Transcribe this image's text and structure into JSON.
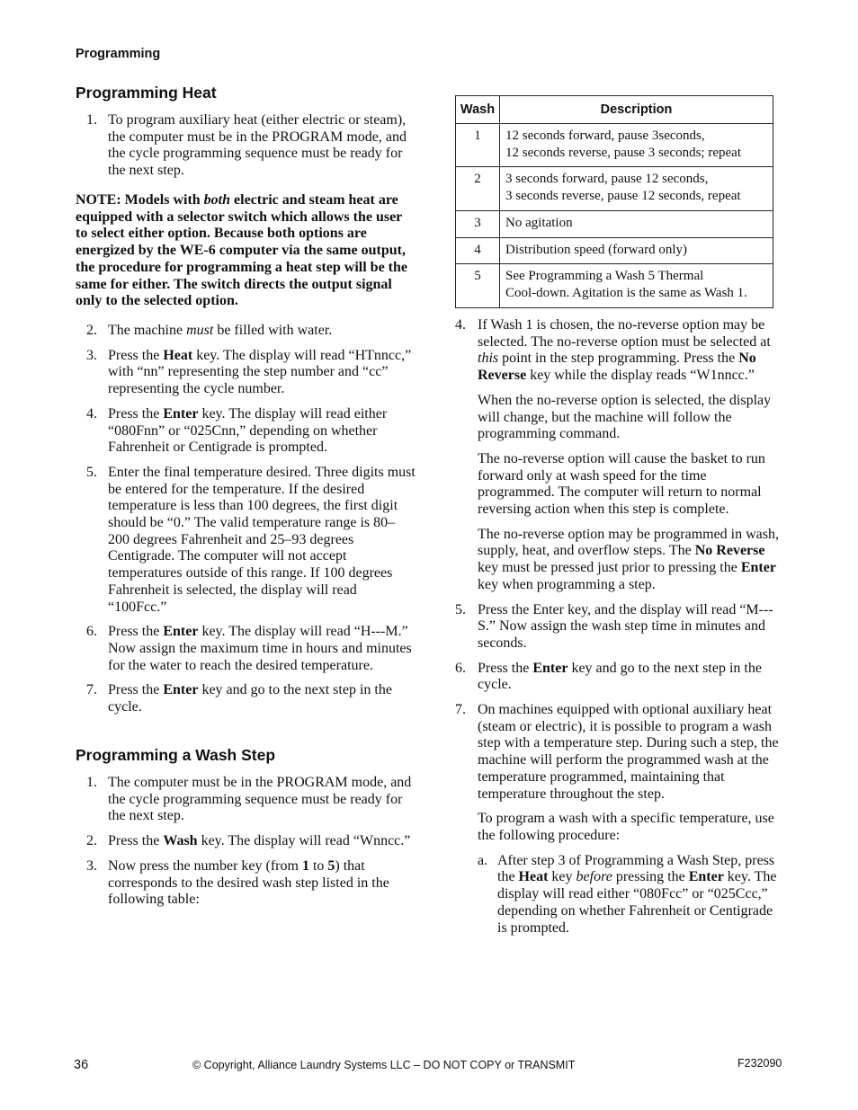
{
  "header": {
    "running_title": "Programming"
  },
  "section_heat": {
    "title": "Programming Heat",
    "step1": {
      "num": "1.",
      "text": [
        {
          "t": "To program auxiliary heat (either electric or steam), the computer must be in the PROGRAM mode, and the cycle programming sequence must be ready for the next step."
        }
      ]
    },
    "note": [
      {
        "t": "NOTE: Models with "
      },
      {
        "t": "both",
        "i": true
      },
      {
        "t": " electric and steam heat are equipped with a selector switch which allows the user to select either option. Because both options are energized by the WE-6 computer via the same output, the procedure for programming a heat step will be the same for either. The switch directs the output signal only to the selected option."
      }
    ],
    "steps": [
      {
        "num": "2.",
        "text": [
          {
            "t": "The machine "
          },
          {
            "t": "must",
            "i": true
          },
          {
            "t": " be filled with water."
          }
        ]
      },
      {
        "num": "3.",
        "text": [
          {
            "t": "Press the "
          },
          {
            "t": "Heat",
            "b": true
          },
          {
            "t": " key. The display will read “HTnncc,” with “nn” representing the step number and “cc” representing the cycle number."
          }
        ]
      },
      {
        "num": "4.",
        "text": [
          {
            "t": "Press the "
          },
          {
            "t": "Enter",
            "b": true
          },
          {
            "t": " key. The display will read either “080Fnn” or “025Cnn,” depending on whether Fahrenheit or Centigrade is prompted."
          }
        ]
      },
      {
        "num": "5.",
        "text": [
          {
            "t": "Enter the final temperature desired. Three digits must be entered for the temperature. If the desired temperature is less than 100 degrees, the first digit should be “0.” The valid temperature range is 80–200 degrees Fahrenheit and 25–93 degrees Centigrade. The computer will not accept temperatures outside of this range. If 100 degrees Fahrenheit is selected, the display will read “100Fcc.”"
          }
        ]
      },
      {
        "num": "6.",
        "text": [
          {
            "t": "Press the "
          },
          {
            "t": "Enter",
            "b": true
          },
          {
            "t": " key. The display will read “H---M.” Now assign the maximum time in hours and minutes for the water to reach the desired temperature."
          }
        ]
      },
      {
        "num": "7.",
        "text": [
          {
            "t": "Press the "
          },
          {
            "t": "Enter",
            "b": true
          },
          {
            "t": " key and go to the next step in the cycle."
          }
        ]
      }
    ]
  },
  "section_wash": {
    "title": "Programming a Wash Step",
    "steps_left": [
      {
        "num": "1.",
        "text": [
          {
            "t": "The computer must be in the PROGRAM mode, and the cycle programming sequence must be ready for the next step."
          }
        ]
      },
      {
        "num": "2.",
        "text": [
          {
            "t": "Press the "
          },
          {
            "t": "Wash",
            "b": true
          },
          {
            "t": " key. The display will read “Wnncc.”"
          }
        ]
      },
      {
        "num": "3.",
        "text": [
          {
            "t": "Now press the number key (from "
          },
          {
            "t": "1",
            "b": true
          },
          {
            "t": " to "
          },
          {
            "t": "5",
            "b": true
          },
          {
            "t": ") that corresponds to the desired wash step listed in the following table:"
          }
        ]
      }
    ],
    "table": {
      "headers": [
        "Wash",
        "Description"
      ],
      "rows": [
        {
          "wash": "1",
          "lines": [
            "12 seconds forward, pause 3seconds,",
            "12 seconds reverse, pause 3 seconds; repeat"
          ]
        },
        {
          "wash": "2",
          "lines": [
            "3 seconds forward, pause 12 seconds,",
            "3 seconds reverse, pause 12 seconds, repeat"
          ]
        },
        {
          "wash": "3",
          "lines": [
            "No agitation"
          ]
        },
        {
          "wash": "4",
          "lines": [
            "Distribution speed (forward only)"
          ]
        },
        {
          "wash": "5",
          "lines": [
            "See Programming a Wash 5 Thermal",
            "Cool-down. Agitation is the same as Wash 1."
          ]
        }
      ]
    },
    "step4": {
      "num": "4.",
      "text": [
        {
          "t": "If Wash 1 is chosen, the no-reverse option may be selected. The no-reverse option must be selected at "
        },
        {
          "t": "this",
          "i": true
        },
        {
          "t": " point in the step programming. Press the "
        },
        {
          "t": "No Reverse",
          "b": true
        },
        {
          "t": " key while the display reads “W1nncc.”"
        }
      ],
      "paragraphs": [
        [
          {
            "t": "When the no-reverse option is selected, the display will change, but the machine will follow the programming command."
          }
        ],
        [
          {
            "t": "The no-reverse option will cause the basket to run forward only at wash speed for the time programmed. The computer will return to normal reversing action when this step is complete."
          }
        ],
        [
          {
            "t": "The no-reverse option may be programmed in wash, supply, heat, and overflow steps. The "
          },
          {
            "t": "No Reverse",
            "b": true
          },
          {
            "t": " key must be pressed just prior to pressing the "
          },
          {
            "t": "Enter",
            "b": true
          },
          {
            "t": " key when programming a step."
          }
        ]
      ]
    },
    "step5": {
      "num": "5.",
      "text": [
        {
          "t": "Press the Enter key, and the display will read “M---S.” Now assign the wash step time in minutes and seconds."
        }
      ]
    },
    "step6": {
      "num": "6.",
      "text": [
        {
          "t": "Press the "
        },
        {
          "t": "Enter",
          "b": true
        },
        {
          "t": " key and go to the next step in the cycle."
        }
      ]
    },
    "step7": {
      "num": "7.",
      "text": [
        {
          "t": "On machines equipped with optional auxiliary heat (steam or electric), it is possible to program a wash step with a temperature step. During such a step, the machine will perform the programmed wash at the temperature programmed, maintaining that temperature throughout the step."
        }
      ],
      "paragraph": [
        {
          "t": "To program a wash with a specific temperature, use the following procedure:"
        }
      ],
      "substep_a": {
        "label": "a.",
        "text": [
          {
            "t": "After step 3 of Programming a Wash Step, press the "
          },
          {
            "t": "Heat",
            "b": true
          },
          {
            "t": " key "
          },
          {
            "t": "before",
            "i": true
          },
          {
            "t": " pressing the "
          },
          {
            "t": "Enter",
            "b": true
          },
          {
            "t": " key. The display will read either “080Fcc” or “025Ccc,” depending on whether Fahrenheit or Centigrade is prompted."
          }
        ]
      }
    }
  },
  "footer": {
    "page_number": "36",
    "copyright": "© Copyright, Alliance Laundry Systems LLC – DO NOT COPY or TRANSMIT",
    "doc_code": "F232090"
  }
}
